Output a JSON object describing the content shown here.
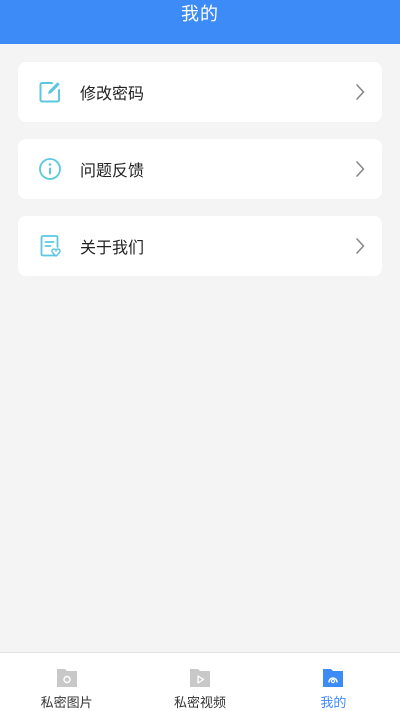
{
  "header": {
    "title": "我的"
  },
  "menu": [
    {
      "label": "修改密码",
      "icon": "edit-icon"
    },
    {
      "label": "问题反馈",
      "icon": "info-icon"
    },
    {
      "label": "关于我们",
      "icon": "document-heart-icon"
    }
  ],
  "tabs": [
    {
      "label": "私密图片",
      "icon": "private-photo-icon",
      "active": false
    },
    {
      "label": "私密视频",
      "icon": "private-video-icon",
      "active": false
    },
    {
      "label": "我的",
      "icon": "profile-icon",
      "active": true
    }
  ],
  "colors": {
    "brand": "#3d8bf7",
    "icon_accent": "#5bc8e0",
    "inactive_icon": "#c8c8c8",
    "background": "#f4f4f4"
  }
}
